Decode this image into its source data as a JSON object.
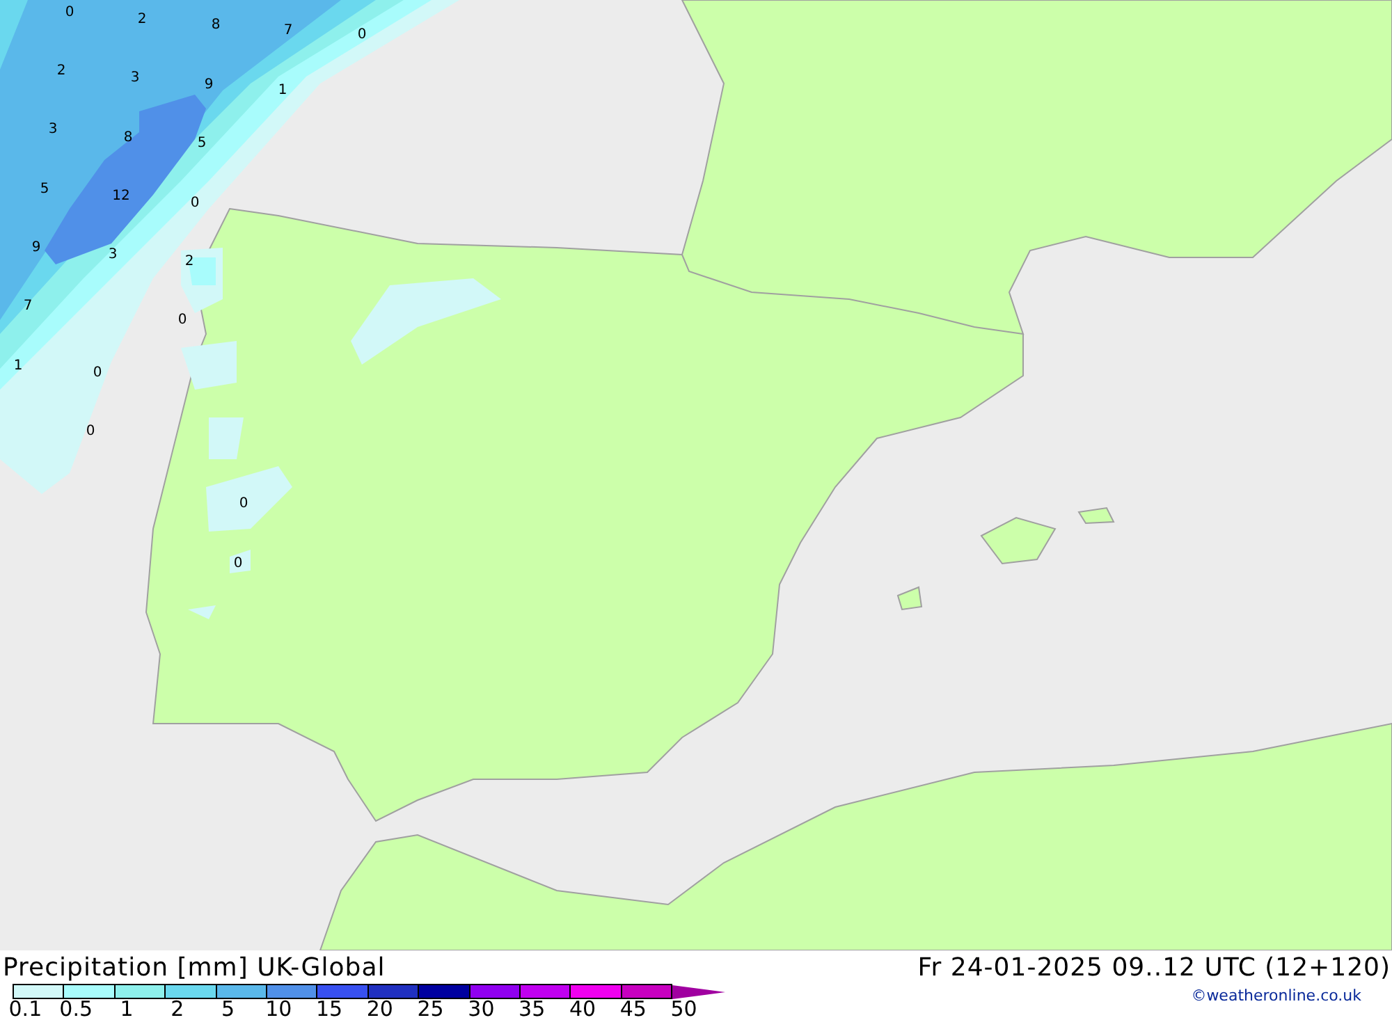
{
  "map": {
    "values": [
      "0",
      "2",
      "8",
      "7",
      "0",
      "2",
      "3",
      "9",
      "1",
      "3",
      "8",
      "5",
      "5",
      "12",
      "0",
      "9",
      "3",
      "2",
      "7",
      "0",
      "1",
      "0",
      "0",
      "0",
      "0"
    ]
  },
  "legend": {
    "title": "Precipitation [mm] UK-Global",
    "bands": [
      {
        "color": "#d2f8f8"
      },
      {
        "color": "#a8fcfc"
      },
      {
        "color": "#8ef0ec"
      },
      {
        "color": "#6ad8ee"
      },
      {
        "color": "#5ab8ea"
      },
      {
        "color": "#5090e8"
      },
      {
        "color": "#3850f0"
      },
      {
        "color": "#2030c0"
      },
      {
        "color": "#0000a0"
      },
      {
        "color": "#9000f0"
      },
      {
        "color": "#c000f0"
      },
      {
        "color": "#f000f0"
      },
      {
        "color": "#c800c0"
      }
    ],
    "ticks": [
      "0.1",
      "0.5",
      "1",
      "2",
      "5",
      "10",
      "15",
      "20",
      "25",
      "30",
      "35",
      "40",
      "45",
      "50"
    ]
  },
  "valid_time": "Fr 24-01-2025 09..12 UTC (12+120)",
  "credit": "©weatheronline.co.uk"
}
